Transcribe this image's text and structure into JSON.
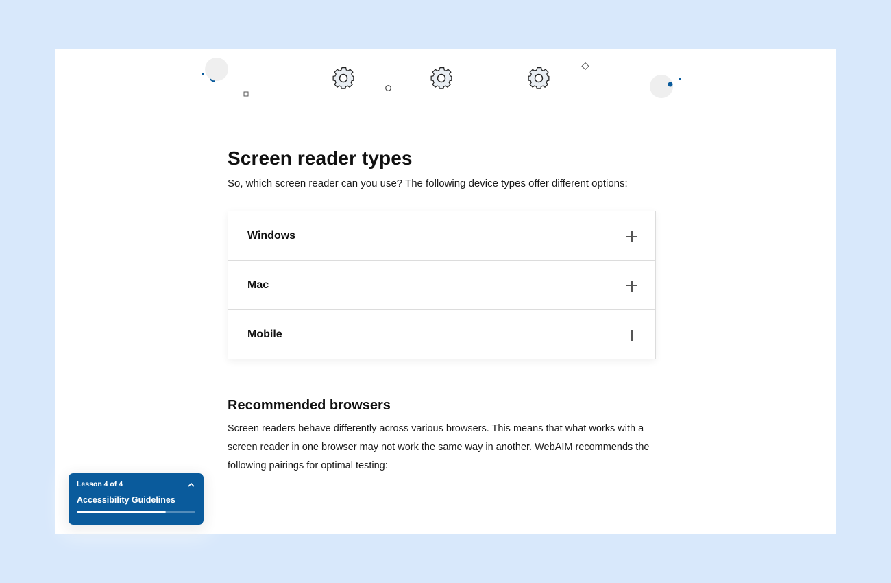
{
  "lesson": {
    "heading": "Screen reader types",
    "intro": "So, which screen reader can you use? The following device types offer different options:",
    "accordion": [
      {
        "label": "Windows",
        "icon": "plus-icon"
      },
      {
        "label": "Mac",
        "icon": "plus-icon"
      },
      {
        "label": "Mobile",
        "icon": "plus-icon"
      }
    ],
    "subheading": "Recommended browsers",
    "paragraph": "Screen readers behave differently across various browsers. This means that what works with a screen reader in one browser may not work the same way in another. WebAIM recommends the following pairings for optimal testing:"
  },
  "lesson_card": {
    "counter": "Lesson 4 of 4",
    "title": "Accessibility Guidelines",
    "progress": 0.75,
    "icon": "chevron-up-icon"
  },
  "colors": {
    "background": "#d8e8fb",
    "accent": "#0a5b9c",
    "card_bg": "#ffffff"
  },
  "decor_icons": [
    "gear-icon",
    "gear-icon",
    "gear-icon"
  ]
}
